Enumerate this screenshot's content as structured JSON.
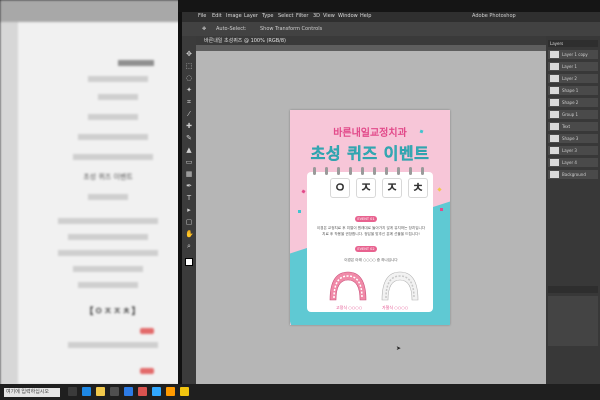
{
  "left_screen": {
    "heading": "초성 퀴즈 이벤트",
    "jamo_line": "【ㅇㅈㅈㅊ】",
    "search_text": "여기에 입력하십시오"
  },
  "photoshop": {
    "menu": [
      "File",
      "Edit",
      "Image",
      "Layer",
      "Type",
      "Select",
      "Filter",
      "3D",
      "View",
      "Window",
      "Help"
    ],
    "title_right": "Adobe Photoshop",
    "options": [
      "Auto-Select:",
      "Show Transform Controls"
    ],
    "doc_tab": "바른내일 초성퀴즈 @ 100% (RGB/8)",
    "layers_header": "Layers",
    "layers": [
      "Layer 1 copy",
      "Layer 1",
      "Layer 2",
      "Shape 1",
      "Shape 2",
      "Group 1",
      "Text",
      "Shape 3",
      "Layer 3",
      "Layer 4",
      "Background"
    ]
  },
  "poster": {
    "subtitle": "바른내일교정치과",
    "title": "초성 퀴즈 이벤트",
    "tiles": [
      "ㅇ",
      "ㅈ",
      "ㅈ",
      "ㅊ"
    ],
    "badge1": "EVENT 01",
    "badge2": "EVENT 02",
    "text1": "이경은 교정치료 후 치열이 원래대로 돌아가지 않게 유지하는 장치입니다",
    "text2": "치료 후 착용을 권장합니다. 정답을 맞추신 분께 선물을 드립니다!",
    "text3": "이경은 아래 ○○○○ 중 하나입니다",
    "label_left": "고정식 ○○○○",
    "label_right": "가철식 ○○○○"
  },
  "colors": {
    "poster_pink": "#f7c6d8",
    "poster_teal": "#5fc9d3",
    "accent_pink": "#e24a8a"
  }
}
